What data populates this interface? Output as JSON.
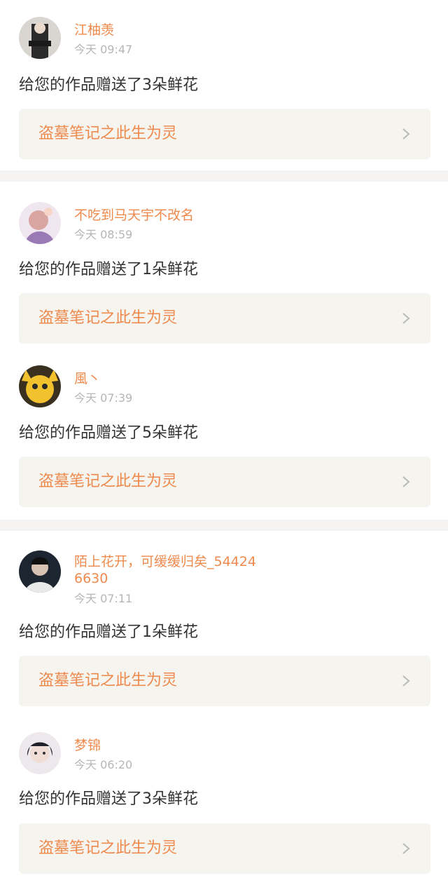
{
  "notifications": [
    {
      "username": "江柚羡",
      "time": "今天 09:47",
      "message": "给您的作品赠送了3朵鲜花",
      "work_title": "盗墓笔记之此生为灵",
      "avatar_icon": "user-avatar-icon"
    },
    {
      "username": "不吃到马天宇不改名",
      "time": "今天 08:59",
      "message": "给您的作品赠送了1朵鲜花",
      "work_title": "盗墓笔记之此生为灵",
      "avatar_icon": "user-avatar-icon"
    },
    {
      "username": "風丶",
      "time": "今天 07:39",
      "message": "给您的作品赠送了5朵鲜花",
      "work_title": "盗墓笔记之此生为灵",
      "avatar_icon": "user-avatar-icon"
    },
    {
      "username": "陌上花开，可缓缓归矣_544246630",
      "time": "今天 07:11",
      "message": "给您的作品赠送了1朵鲜花",
      "work_title": "盗墓笔记之此生为灵",
      "avatar_icon": "user-avatar-icon"
    },
    {
      "username": "梦锦",
      "time": "今天 06:20",
      "message": "给您的作品赠送了3朵鲜花",
      "work_title": "盗墓笔记之此生为灵",
      "avatar_icon": "user-avatar-icon"
    }
  ],
  "icons": {
    "chevron": "chevron-right-icon"
  },
  "colors": {
    "accent": "#ee8a4d",
    "text": "#333333",
    "muted": "#b6b6b6",
    "card_bg": "#f5f4ef",
    "separator": "#f4f3f1"
  }
}
